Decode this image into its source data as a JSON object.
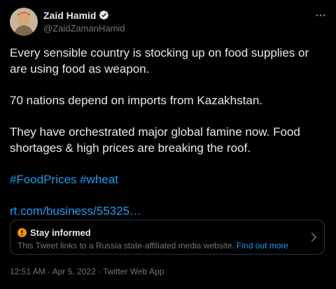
{
  "author": {
    "name": "Zaid Hamid",
    "handle": "@ZaidZamanHamid"
  },
  "tweet": {
    "para1": "Every sensible country is stocking up on food supplies or are using food as weapon.",
    "para2": "70 nations depend on imports from Kazakhstan.",
    "para3": "They have orchestrated major global famine now. Food shortages & high prices are breaking the roof.",
    "hashtag1": "#FoodPrices",
    "hashtag2": "#wheat",
    "link": "rt.com/business/55325…"
  },
  "notice": {
    "title": "Stay informed",
    "text": "This Tweet links to a Russia state-affiliated media website.",
    "link": "Find out more"
  },
  "meta": {
    "time": "12:51 AM",
    "sep1": " · ",
    "date": "Apr 5, 2022",
    "sep2": " · ",
    "source": "Twitter Web App"
  },
  "colors": {
    "background": "#000000",
    "text": "#e7e9ea",
    "muted": "#71767b",
    "accent": "#1d9bf0",
    "warning": "#f4900c"
  },
  "icons": {
    "verified": "verified-badge-icon",
    "more": "more-options-icon",
    "warning": "warning-icon",
    "chevron": "chevron-right-icon"
  }
}
